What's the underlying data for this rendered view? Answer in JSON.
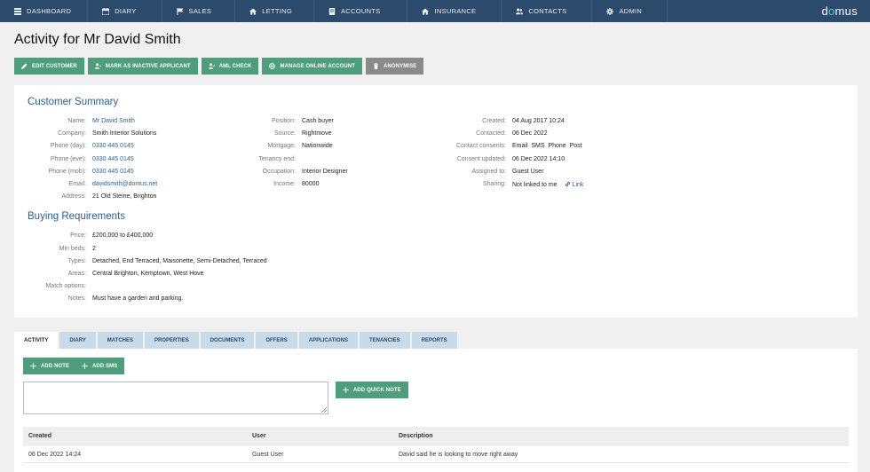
{
  "nav": {
    "items": [
      {
        "label": "DASHBOARD",
        "icon": "dashboard-icon"
      },
      {
        "label": "DIARY",
        "icon": "calendar-icon"
      },
      {
        "label": "SALES",
        "icon": "flag-icon"
      },
      {
        "label": "LETTING",
        "icon": "home-icon"
      },
      {
        "label": "ACCOUNTS",
        "icon": "ledger-icon"
      },
      {
        "label": "INSURANCE",
        "icon": "home-icon"
      },
      {
        "label": "CONTACTS",
        "icon": "users-icon"
      },
      {
        "label": "ADMIN",
        "icon": "gear-icon"
      }
    ],
    "brand_prefix": "d",
    "brand_o": "o",
    "brand_suffix": "mus"
  },
  "page": {
    "title": "Activity for Mr David Smith"
  },
  "actions": {
    "edit": "EDIT CUSTOMER",
    "inactive": "MARK AS INACTIVE APPLICANT",
    "aml": "AML CHECK",
    "online": "MANAGE ONLINE ACCOUNT",
    "anonymise": "ANONYMISE"
  },
  "summary": {
    "title": "Customer Summary",
    "col1": [
      {
        "label": "Name:",
        "value": "Mr David Smith",
        "link": true
      },
      {
        "label": "Company:",
        "value": "Smith Interior Solutions",
        "link": false
      },
      {
        "label": "Phone (day):",
        "value": "0330 445 0145",
        "link": true
      },
      {
        "label": "Phone (eve):",
        "value": "0330 445 0145",
        "link": true
      },
      {
        "label": "Phone (mob):",
        "value": "0330 445 0145",
        "link": true
      },
      {
        "label": "Email:",
        "value": "davidsmith@domus.net",
        "link": true
      },
      {
        "label": "Address:",
        "value": "21 Old Steine, Brighton",
        "link": false
      }
    ],
    "col2": [
      {
        "label": "Position:",
        "value": "Cash buyer"
      },
      {
        "label": "Source:",
        "value": "Rightmove"
      },
      {
        "label": "Mortgage:",
        "value": "Nationwide"
      },
      {
        "label": "Tenancy end:",
        "value": ""
      },
      {
        "label": "Occupation:",
        "value": "Interior Designer"
      },
      {
        "label": "Income:",
        "value": "80000"
      }
    ],
    "col3": [
      {
        "label": "Created:",
        "value": "04 Aug 2017 10:24"
      },
      {
        "label": "Contacted:",
        "value": "06 Dec 2022"
      },
      {
        "label": "Contact consents:",
        "value": "Email  SMS  Phone  Post"
      },
      {
        "label": "Consent updated:",
        "value": "06 Dec 2022 14:10"
      },
      {
        "label": "Assigned to:",
        "value": "Guest User"
      },
      {
        "label": "Sharing:",
        "value": "Not linked to me"
      }
    ],
    "share_link": "Link"
  },
  "requirements": {
    "title": "Buying Requirements",
    "rows": [
      {
        "label": "Price:",
        "value": "£200,000 to £400,000"
      },
      {
        "label": "Min beds:",
        "value": "2"
      },
      {
        "label": "Types:",
        "value": "Detached, End Terraced, Maisonette, Semi-Detached, Terraced"
      },
      {
        "label": "Areas:",
        "value": "Central Brighton, Kemptown, West Hove"
      },
      {
        "label": "Match options:",
        "value": ""
      },
      {
        "label": "Notes:",
        "value": "Must have a garden and parking."
      }
    ]
  },
  "tabs": [
    "ACTIVITY",
    "DIARY",
    "MATCHES",
    "PROPERTIES",
    "DOCUMENTS",
    "OFFERS",
    "APPLICATIONS",
    "TENANCIES",
    "REPORTS"
  ],
  "activity": {
    "add_note": "ADD NOTE",
    "add_sms": "ADD SMS",
    "add_quick_note": "ADD QUICK NOTE",
    "note_value": "",
    "columns": [
      "Created",
      "User",
      "Description"
    ],
    "rows": [
      {
        "created": "06 Dec 2022 14:24",
        "user": "Guest User",
        "description": "David said he is looking to move right away"
      }
    ]
  },
  "colors": {
    "nav": "#2c4a6b",
    "accent": "#4e9e7d",
    "link": "#2c5f8f",
    "tab": "#c9dbe8"
  }
}
